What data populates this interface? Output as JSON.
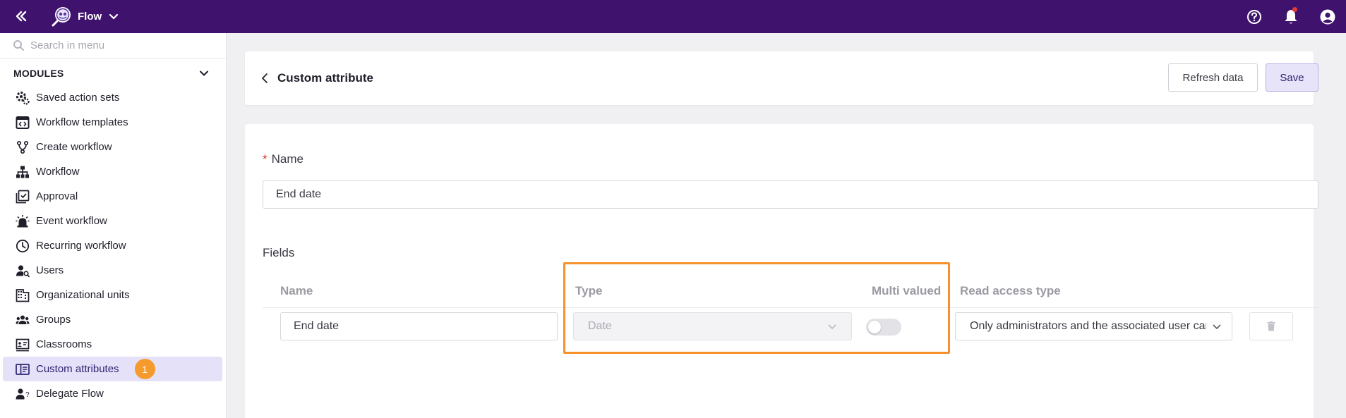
{
  "topbar": {
    "app_name": "Flow",
    "bg_color": "#3f136d",
    "icons": [
      "collapse-menu-icon",
      "help-icon",
      "notification-bell-icon",
      "account-icon"
    ]
  },
  "sidebar": {
    "search_placeholder": "Search in menu",
    "modules_label": "MODULES",
    "items": [
      {
        "label": "Saved action sets",
        "icon": "gear-cog-icon"
      },
      {
        "label": "Workflow templates",
        "icon": "template-icon"
      },
      {
        "label": "Create workflow",
        "icon": "branch-icon"
      },
      {
        "label": "Workflow",
        "icon": "hierarchy-icon"
      },
      {
        "label": "Approval",
        "icon": "approval-icon"
      },
      {
        "label": "Event workflow",
        "icon": "alarm-icon"
      },
      {
        "label": "Recurring workflow",
        "icon": "clock-icon"
      },
      {
        "label": "Users",
        "icon": "user-search-icon"
      },
      {
        "label": "Organizational units",
        "icon": "building-icon"
      },
      {
        "label": "Groups",
        "icon": "group-icon"
      },
      {
        "label": "Classrooms",
        "icon": "classroom-icon"
      },
      {
        "label": "Custom attributes",
        "icon": "custom-attribute-icon",
        "active": true,
        "badge": "1"
      },
      {
        "label": "Delegate Flow",
        "icon": "delegate-user-icon"
      }
    ]
  },
  "header": {
    "title": "Custom attribute",
    "refresh_label": "Refresh data",
    "save_label": "Save"
  },
  "form": {
    "name_required_mark": "*",
    "name_label": "Name",
    "name_value": "End date",
    "fields_label": "Fields",
    "columns": {
      "name": "Name",
      "type": "Type",
      "multi_valued": "Multi valued",
      "read_access_type": "Read access type"
    },
    "row": {
      "name_value": "End date",
      "type_value": "Date",
      "multi_valued": false,
      "read_access_value": "Only administrators and the associated user can"
    }
  },
  "colors": {
    "accent": "#3f136d",
    "highlight": "#f5922b",
    "active_bg": "#e4e1f8",
    "badge": "#f59a2c"
  }
}
